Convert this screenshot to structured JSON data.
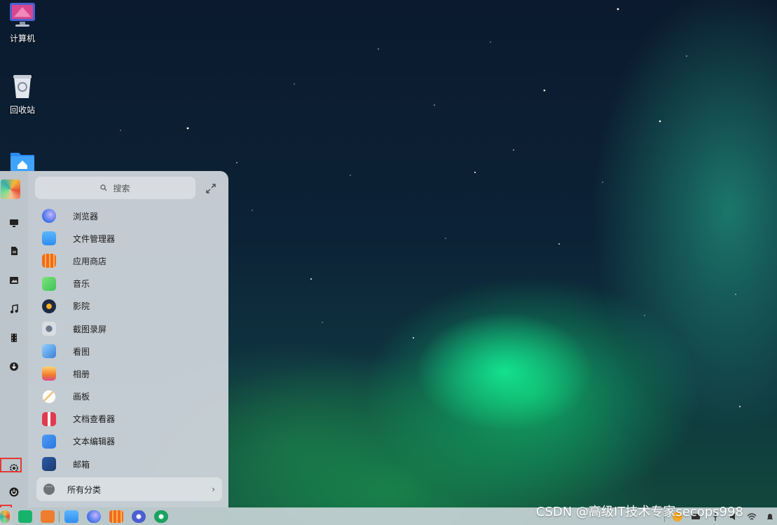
{
  "desktop": {
    "icons": [
      {
        "label": "计算机",
        "icon": "computer-icon"
      },
      {
        "label": "回收站",
        "icon": "trash-icon"
      },
      {
        "label": "",
        "icon": "home-folder-icon"
      }
    ]
  },
  "launcher": {
    "search_placeholder": "搜索",
    "apps": [
      {
        "label": "浏览器",
        "icon": "browser-icon",
        "color": "#3d6ee8"
      },
      {
        "label": "文件管理器",
        "icon": "file-manager-icon",
        "color": "#2f8ef0"
      },
      {
        "label": "应用商店",
        "icon": "app-store-icon",
        "color": "#f26a21"
      },
      {
        "label": "音乐",
        "icon": "music-icon",
        "color": "#3fc35a"
      },
      {
        "label": "影院",
        "icon": "video-icon",
        "color": "#1f2a44"
      },
      {
        "label": "截图录屏",
        "icon": "screenshot-icon",
        "color": "#d9dde3"
      },
      {
        "label": "看图",
        "icon": "image-viewer-icon",
        "color": "#3b7fd6"
      },
      {
        "label": "相册",
        "icon": "album-icon",
        "color": "#f07c2e"
      },
      {
        "label": "画板",
        "icon": "draw-icon",
        "color": "#f2f2f2"
      },
      {
        "label": "文档查看器",
        "icon": "document-viewer-icon",
        "color": "#e03a4e"
      },
      {
        "label": "文本编辑器",
        "icon": "text-editor-icon",
        "color": "#2a77e0"
      },
      {
        "label": "邮箱",
        "icon": "mail-icon",
        "color": "#1e3a6e"
      }
    ],
    "all_categories": "所有分类",
    "side": [
      "desktop-icon",
      "document-icon",
      "picture-icon",
      "music-icon",
      "video-icon",
      "download-icon",
      "settings-icon",
      "power-icon"
    ]
  },
  "watermark": "CSDN @高级IT技术专家secops998",
  "colors": {
    "highlight": "#e53935"
  }
}
